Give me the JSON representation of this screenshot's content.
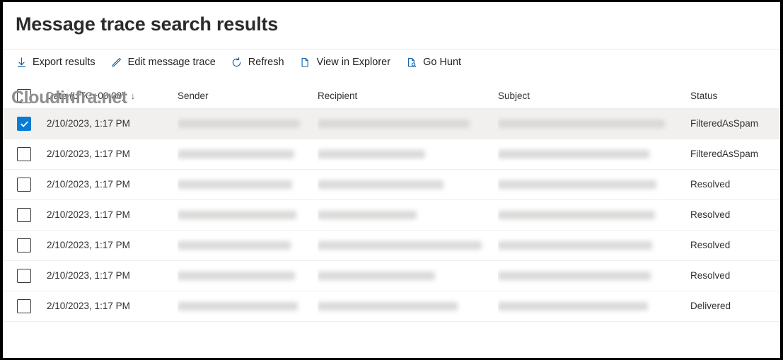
{
  "header": {
    "title": "Message trace search results"
  },
  "watermark": "Cloudinfra.net",
  "toolbar": {
    "items": [
      {
        "label": "Export results",
        "icon": "download-icon"
      },
      {
        "label": "Edit message trace",
        "icon": "pencil-icon"
      },
      {
        "label": "Refresh",
        "icon": "refresh-icon"
      },
      {
        "label": "View in Explorer",
        "icon": "page-copy-icon"
      },
      {
        "label": "Go Hunt",
        "icon": "document-search-icon"
      }
    ]
  },
  "table": {
    "select_all_checked": false,
    "columns": [
      {
        "key": "date",
        "label": "Date (UTC+00:00)",
        "sort": "↓"
      },
      {
        "key": "sender",
        "label": "Sender"
      },
      {
        "key": "recipient",
        "label": "Recipient"
      },
      {
        "key": "subject",
        "label": "Subject"
      },
      {
        "key": "status",
        "label": "Status"
      }
    ],
    "rows": [
      {
        "selected": true,
        "date": "2/10/2023, 1:17 PM",
        "sender": "",
        "recipient": "",
        "subject": "",
        "status": "FilteredAsSpam",
        "sender_w": 173,
        "recipient_w": 215,
        "subject_w": 236
      },
      {
        "selected": false,
        "date": "2/10/2023, 1:17 PM",
        "sender": "",
        "recipient": "",
        "subject": "",
        "status": "FilteredAsSpam",
        "sender_w": 165,
        "recipient_w": 152,
        "subject_w": 214
      },
      {
        "selected": false,
        "date": "2/10/2023, 1:17 PM",
        "sender": "",
        "recipient": "",
        "subject": "",
        "status": "Resolved",
        "sender_w": 162,
        "recipient_w": 178,
        "subject_w": 224
      },
      {
        "selected": false,
        "date": "2/10/2023, 1:17 PM",
        "sender": "",
        "recipient": "",
        "subject": "",
        "status": "Resolved",
        "sender_w": 168,
        "recipient_w": 140,
        "subject_w": 222
      },
      {
        "selected": false,
        "date": "2/10/2023, 1:17 PM",
        "sender": "",
        "recipient": "",
        "subject": "",
        "status": "Resolved",
        "sender_w": 160,
        "recipient_w": 232,
        "subject_w": 218
      },
      {
        "selected": false,
        "date": "2/10/2023, 1:17 PM",
        "sender": "",
        "recipient": "",
        "subject": "",
        "status": "Resolved",
        "sender_w": 166,
        "recipient_w": 166,
        "subject_w": 216
      },
      {
        "selected": false,
        "date": "2/10/2023, 1:17 PM",
        "sender": "",
        "recipient": "",
        "subject": "",
        "status": "Delivered",
        "sender_w": 170,
        "recipient_w": 198,
        "subject_w": 212
      }
    ]
  },
  "colors": {
    "accent": "#0a7bd4",
    "selected_row_bg": "#f1f0ef",
    "text": "#323130",
    "watermark": "#8f8f8f"
  }
}
